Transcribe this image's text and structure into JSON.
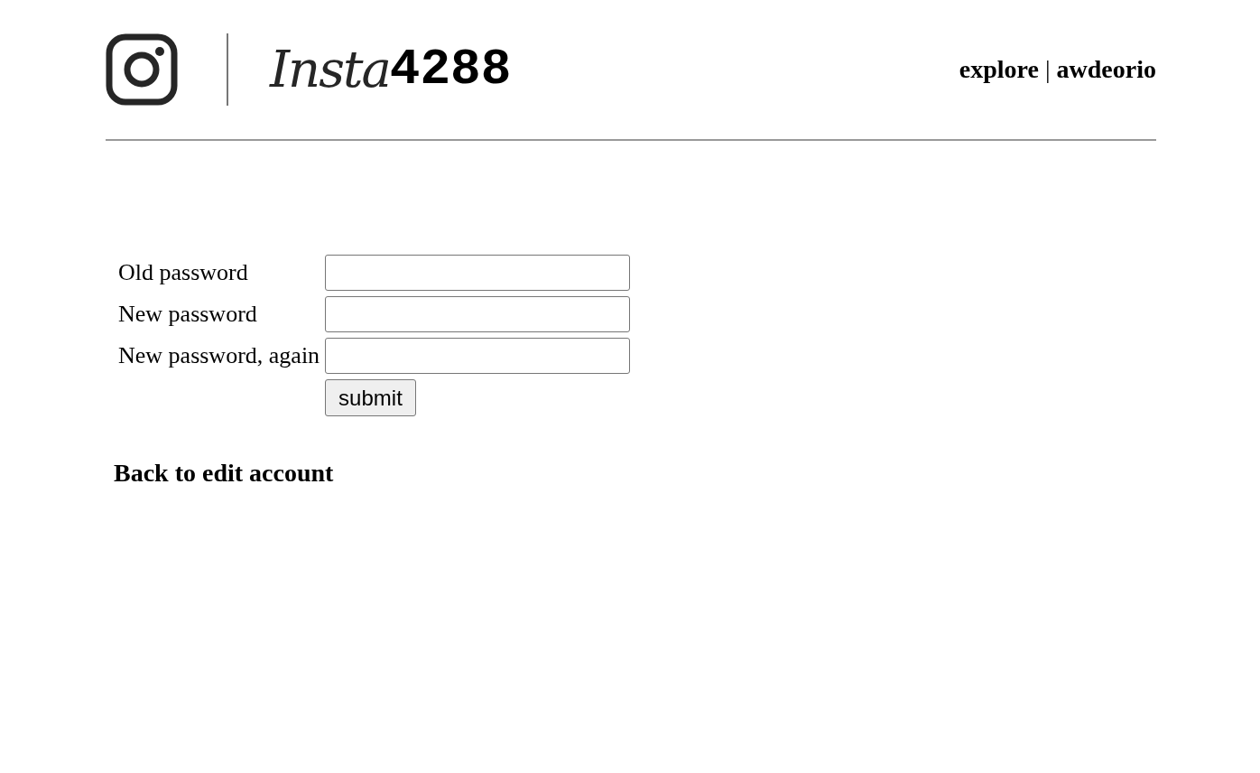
{
  "header": {
    "logo_script": "Insta",
    "logo_number": "4288",
    "nav": [
      {
        "label": "explore"
      },
      {
        "label": "awdeorio"
      }
    ],
    "nav_separator": "|"
  },
  "form": {
    "fields": [
      {
        "label": "Old password"
      },
      {
        "label": "New password"
      },
      {
        "label": "New password, again"
      }
    ],
    "submit": "submit"
  },
  "back_link": "Back to edit account"
}
